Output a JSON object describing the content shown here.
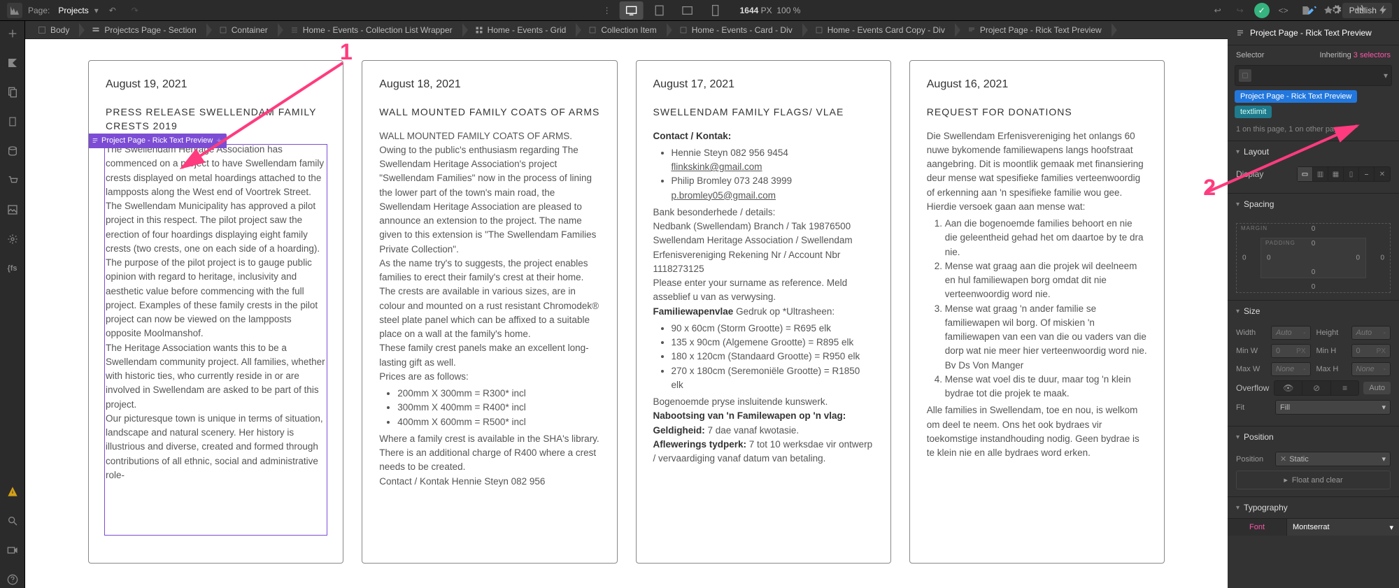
{
  "topbar": {
    "page_label": "Page:",
    "page_name": "Projects",
    "zoom_px": "1644",
    "zoom_unit": "PX",
    "zoom_pct": "100 %",
    "publish": "Publish"
  },
  "breadcrumb": [
    "Body",
    "Projectcs Page - Section",
    "Container",
    "Home - Events - Collection List Wrapper",
    "Home - Events - Grid",
    "Collection Item",
    "Home - Events - Card - Div",
    "Home - Events Card Copy - Div",
    "Project Page - Rick Text Preview"
  ],
  "leftbar_fs": "{fs",
  "cards": [
    {
      "date": "August 19, 2021",
      "title": "PRESS RELEASE SWELLENDAM FAMILY CRESTS 2019",
      "sel_label": "Project Page - Rick Text Preview",
      "body_html": "The Swellendam Heritage Association has commenced on a project to have Swellendam family crests displayed on metal hoardings attached to the lampposts along the West end of Voortrek Street. The Swellendam Municipality has approved a pilot project in this respect. The pilot project saw the erection of four hoardings displaying eight family crests (two crests, one on each side of a hoarding). The purpose of the pilot project is to gauge public opinion with regard to heritage, inclusivity and aesthetic value before commencing with the full project. Examples of these family crests in the pilot project can now be viewed on the lampposts opposite Moolmanshof.<br>The Heritage Association wants this to be a Swellendam community project. All families, whether with historic ties, who currently reside in or are involved in Swellendam are asked to be part of this project.<br>Our picturesque town is unique in terms of situation, landscape and natural scenery. Her history is illustrious and diverse, created and formed through contributions of all ethnic, social and administrative role-"
    },
    {
      "date": "August 18, 2021",
      "title": "WALL MOUNTED FAMILY COATS OF ARMS",
      "body_html": "WALL MOUNTED FAMILY COATS OF ARMS.<br>Owing to the public's enthusiasm regarding The Swellendam Heritage Association's project \"Swellendam Families\" now in the process of lining the lower part of the town's main road, the Swellendam Heritage Association are pleased to announce an extension to the project. The name given to this extension is \"The Swellendam Families Private Collection\".<br>As the name try's to suggests, the project enables families to erect their family's crest at their home.<br>The crests are available in various sizes, are in colour and mounted on a rust resistant Chromodek® steel plate panel which can be affixed to a suitable place on a wall at the family's home.<br>These family crest panels make an excellent long-lasting gift as well.<br>Prices are as follows:<ul><li>200mm X 300mm = R300* incl</li><li>300mm X 400mm = R400* incl</li><li>400mm X 600mm = R500* incl</li></ul>Where a family crest is available in the SHA's library.<br>There is an additional charge of R400 where a crest needs to be created.<br>Contact / Kontak Hennie Steyn 082 956"
    },
    {
      "date": "August 17, 2021",
      "title": "SWELLENDAM FAMILY FLAGS/ VLAE",
      "body_html": "<b>Contact / Kontak:</b><ul><li>Hennie Steyn 082 956 9454 <a>flinkskink@gmail.com</a></li><li>Philip Bromley 073 248 3999 <a>p.bromley05@gmail.com</a></li></ul>Bank besonderhede / details:<br>Nedbank (Swellendam) Branch / Tak 19876500 Swellendam Heritage Association / Swellendam Erfenisvereniging Rekening Nr / Account Nbr 1118273125<br>Please enter your surname as reference. Meld asseblief u van as verwysing.<br><b>Familiewapenvlae</b> Gedruk op *Ultrasheen:<ul><li>90 x 60cm (Storm Grootte) = R695 elk</li><li>135 x 90cm (Algemene Grootte) = R895 elk</li><li>180 x 120cm (Standaard Grootte) = R950 elk</li><li>270 x 180cm (Seremoniële Grootte) = R1850 elk</li></ul>Bogenoemde pryse insluitende kunswerk.<br><b>Nabootsing van 'n Familewapen op 'n vlag:</b><br><b>Geldigheid:</b> 7 dae vanaf kwotasie.<br><b>Aflewerings tydperk:</b> 7 tot 10 werksdae vir ontwerp / vervaardiging vanaf datum van betaling."
    },
    {
      "date": "August 16, 2021",
      "title": "REQUEST FOR DONATIONS",
      "body_html": "Die Swellendam Erfenisvereniging het onlangs 60 nuwe bykomende familiewapens langs hoofstraat aangebring. Dit is moontlik gemaak met finansiering deur mense wat spesifieke families verteenwoordig of erkenning aan 'n spesifieke familie wou gee.<br>Hierdie versoek gaan aan mense wat:<ol><li>Aan die bogenoemde families behoort en nie die geleentheid gehad het om daartoe by te dra nie.</li><li>Mense wat graag aan die projek wil deelneem en hul familiewapen borg omdat dit nie verteenwoordig word nie.</li><li>Mense wat graag 'n ander familie se familiewapen wil borg. Of miskien 'n familiewapen van een van die ou vaders van die dorp wat nie meer hier verteenwoordig word nie. Bv Ds Von Manger</li><li>Mense wat voel dis te duur, maar tog 'n klein bydrae tot die projek te maak.</li></ol>Alle families in Swellendam, toe en nou, is welkom om deel te neem. Ons het ook bydraes vir toekomstige instandhouding nodig. Geen bydrae is te klein nie en alle bydraes word erken."
    }
  ],
  "rightpanel": {
    "title": "Project Page - Rick Text Preview",
    "selector_label": "Selector",
    "inheriting": "Inheriting",
    "inheriting_count": "3 selectors",
    "tag_main": "Project Page - Rick Text Preview",
    "tag_extra": "textlimit",
    "caption": "1 on this page, 1 on other pages.",
    "layout": "Layout",
    "display": "Display",
    "spacing": "Spacing",
    "margin": "MARGIN",
    "padding": "PADDING",
    "sp0": "0",
    "size": "Size",
    "width": "Width",
    "height": "Height",
    "minw": "Min W",
    "maxw": "Max W",
    "minh": "Min H",
    "maxh": "Max H",
    "auto": "Auto",
    "none": "None",
    "px": "PX",
    "dash": "-",
    "zero": "0",
    "overflow": "Overflow",
    "fit": "Fit",
    "fill": "Fill",
    "position": "Position",
    "static": "Static",
    "floatclear": "Float and clear",
    "typography": "Typography",
    "font": "Font",
    "fontval": "Montserrat"
  },
  "annotations": {
    "one": "1",
    "two": "2"
  }
}
